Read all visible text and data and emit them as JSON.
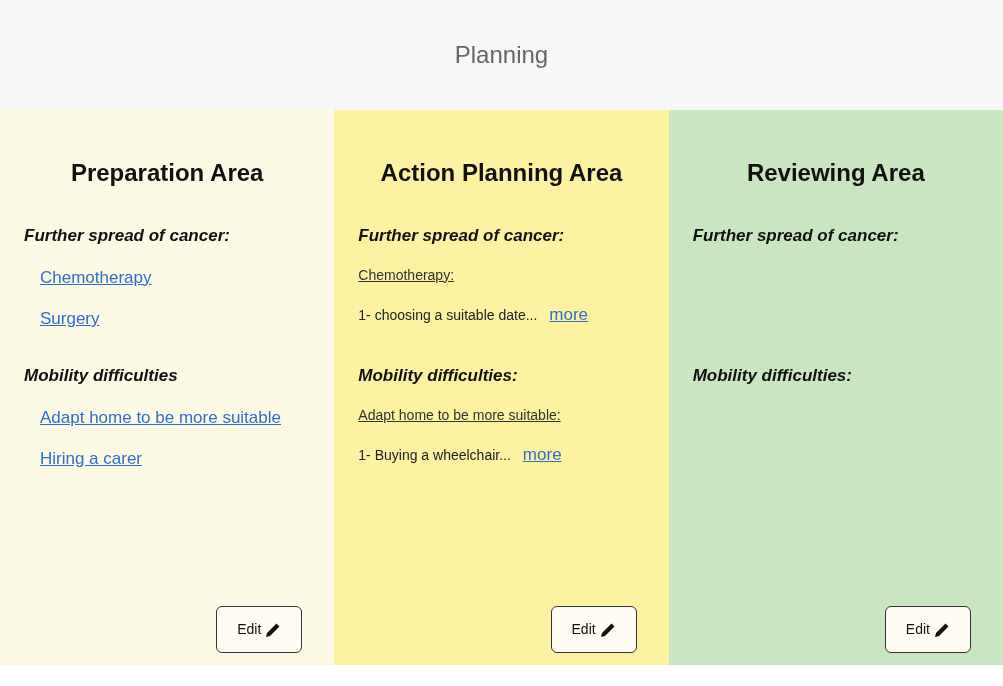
{
  "header": {
    "title": "Planning"
  },
  "areas": [
    {
      "title": "Preparation Area",
      "color": "#fcf9e4",
      "sections": [
        {
          "heading": "Further spread of cancer:",
          "items": [
            {
              "kind": "link",
              "text": "Chemotherapy"
            },
            {
              "kind": "link",
              "text": "Surgery"
            }
          ]
        },
        {
          "heading": "Mobility difficulties",
          "items": [
            {
              "kind": "link",
              "text": "Adapt home to be more suitable"
            },
            {
              "kind": "link",
              "text": "Hiring a carer"
            }
          ]
        }
      ],
      "edit": "Edit"
    },
    {
      "title": "Action Planning Area",
      "color": "#fdf2a2",
      "sections": [
        {
          "heading": "Further spread of cancer:",
          "items": [
            {
              "kind": "subtitle",
              "text": "Chemotherapy:"
            },
            {
              "kind": "note",
              "text": "1- choosing a suitable date...",
              "more": "more"
            }
          ]
        },
        {
          "heading": "Mobility difficulties:",
          "items": [
            {
              "kind": "subtitle",
              "text": "Adapt home to be more suitable:"
            },
            {
              "kind": "note",
              "text": "1- Buying a wheelchair...",
              "more": "more"
            }
          ]
        }
      ],
      "edit": "Edit"
    },
    {
      "title": "Reviewing Area",
      "color": "#c9e6c1",
      "sections": [
        {
          "heading": "Further spread of cancer:"
        },
        {
          "heading": "Mobility difficulties:"
        }
      ],
      "edit": "Edit"
    }
  ]
}
